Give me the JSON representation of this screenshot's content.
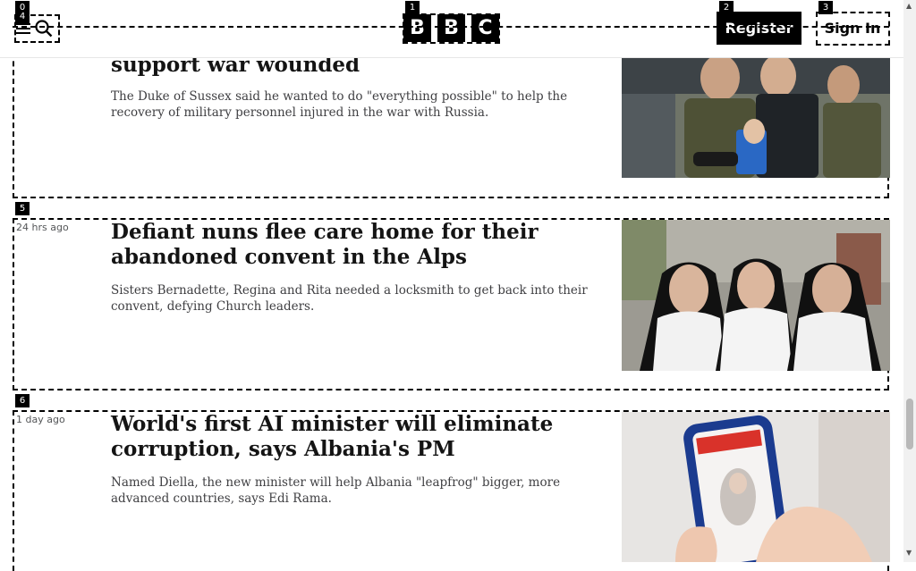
{
  "header": {
    "logo_letters": [
      "B",
      "B",
      "C"
    ],
    "register_label": "Register",
    "signin_label": "Sign In",
    "menu_icon": "menu-icon",
    "search_icon": "search-icon"
  },
  "tags": [
    "0",
    "1",
    "2",
    "3",
    "4",
    "5",
    "6"
  ],
  "stories": [
    {
      "time": "",
      "headline": "support war wounded",
      "summary": "The Duke of Sussex said he wanted to do \"everything possible\" to help the recovery of military personnel injured in the war with Russia."
    },
    {
      "time": "24 hrs ago",
      "headline": "Defiant nuns flee care home for their abandoned convent in the Alps",
      "summary": "Sisters Bernadette, Regina and Rita needed a locksmith to get back into their convent, defying Church leaders."
    },
    {
      "time": "1 day ago",
      "headline": "World's first AI minister will eliminate corruption, says Albania's PM",
      "summary": "Named Diella, the new minister will help Albania \"leapfrog\" bigger, more advanced countries, says Edi Rama."
    }
  ]
}
